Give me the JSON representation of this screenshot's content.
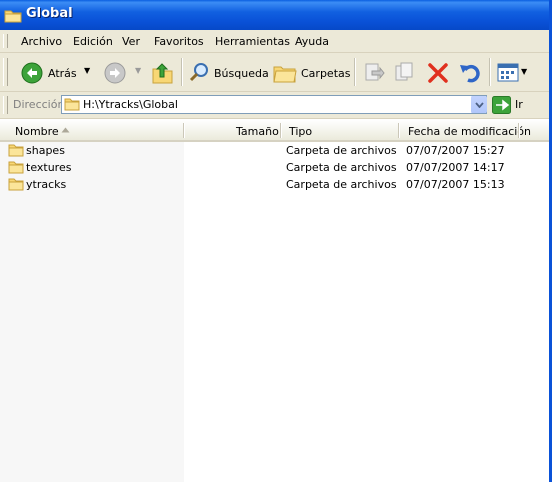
{
  "window": {
    "title": "Global"
  },
  "menu": [
    "Archivo",
    "Edición",
    "Ver",
    "Favoritos",
    "Herramientas",
    "Ayuda"
  ],
  "toolbar": {
    "back_label": "Atrás",
    "search_label": "Búsqueda",
    "folders_label": "Carpetas"
  },
  "address": {
    "label": "Dirección",
    "value": "H:\\Ytracks\\Global",
    "go_label": "Ir"
  },
  "columns": {
    "name": "Nombre",
    "size": "Tamaño",
    "type": "Tipo",
    "modified": "Fecha de modificación"
  },
  "files": [
    {
      "name": "shapes",
      "size": "",
      "type": "Carpeta de archivos",
      "modified": "07/07/2007 15:27"
    },
    {
      "name": "textures",
      "size": "",
      "type": "Carpeta de archivos",
      "modified": "07/07/2007 14:17"
    },
    {
      "name": "ytracks",
      "size": "",
      "type": "Carpeta de archivos",
      "modified": "07/07/2007 15:13"
    }
  ],
  "colors": {
    "titlebar": "#0A52D8",
    "chrome": "#ECE9D8",
    "sorted_column": "#F7F7F7"
  }
}
